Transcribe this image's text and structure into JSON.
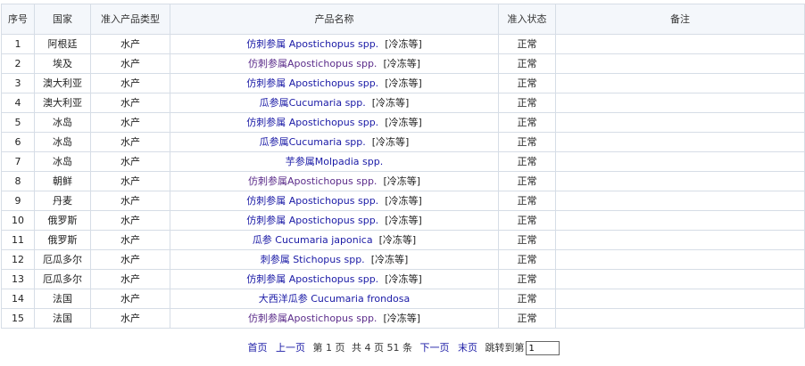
{
  "table": {
    "headers": [
      "序号",
      "国家",
      "准入产品类型",
      "产品名称",
      "准入状态",
      "备注"
    ],
    "rows": [
      {
        "idx": "1",
        "country": "阿根廷",
        "type": "水产",
        "name": "仿刺参属 Apostichopus spp.",
        "suffix": "[冷冻等]",
        "visited": false,
        "status": "正常",
        "note": ""
      },
      {
        "idx": "2",
        "country": "埃及",
        "type": "水产",
        "name": "仿刺参属Apostichopus spp.",
        "suffix": "[冷冻等]",
        "visited": true,
        "status": "正常",
        "note": ""
      },
      {
        "idx": "3",
        "country": "澳大利亚",
        "type": "水产",
        "name": "仿刺参属 Apostichopus spp.",
        "suffix": "[冷冻等]",
        "visited": false,
        "status": "正常",
        "note": ""
      },
      {
        "idx": "4",
        "country": "澳大利亚",
        "type": "水产",
        "name": "瓜参属Cucumaria spp.",
        "suffix": "[冷冻等]",
        "visited": false,
        "status": "正常",
        "note": ""
      },
      {
        "idx": "5",
        "country": "冰岛",
        "type": "水产",
        "name": "仿刺参属 Apostichopus spp.",
        "suffix": "[冷冻等]",
        "visited": false,
        "status": "正常",
        "note": ""
      },
      {
        "idx": "6",
        "country": "冰岛",
        "type": "水产",
        "name": "瓜参属Cucumaria spp.",
        "suffix": "[冷冻等]",
        "visited": false,
        "status": "正常",
        "note": ""
      },
      {
        "idx": "7",
        "country": "冰岛",
        "type": "水产",
        "name": "芋参属Molpadia spp.",
        "suffix": "",
        "visited": false,
        "status": "正常",
        "note": ""
      },
      {
        "idx": "8",
        "country": "朝鲜",
        "type": "水产",
        "name": "仿刺参属Apostichopus spp.",
        "suffix": "[冷冻等]",
        "visited": true,
        "status": "正常",
        "note": ""
      },
      {
        "idx": "9",
        "country": "丹麦",
        "type": "水产",
        "name": "仿刺参属 Apostichopus spp.",
        "suffix": "[冷冻等]",
        "visited": false,
        "status": "正常",
        "note": ""
      },
      {
        "idx": "10",
        "country": "俄罗斯",
        "type": "水产",
        "name": "仿刺参属 Apostichopus spp.",
        "suffix": "[冷冻等]",
        "visited": false,
        "status": "正常",
        "note": ""
      },
      {
        "idx": "11",
        "country": "俄罗斯",
        "type": "水产",
        "name": "瓜参 Cucumaria japonica",
        "suffix": "[冷冻等]",
        "visited": false,
        "status": "正常",
        "note": ""
      },
      {
        "idx": "12",
        "country": "厄瓜多尔",
        "type": "水产",
        "name": "刺参属 Stichopus spp.",
        "suffix": "[冷冻等]",
        "visited": false,
        "status": "正常",
        "note": ""
      },
      {
        "idx": "13",
        "country": "厄瓜多尔",
        "type": "水产",
        "name": "仿刺参属 Apostichopus spp.",
        "suffix": "[冷冻等]",
        "visited": false,
        "status": "正常",
        "note": ""
      },
      {
        "idx": "14",
        "country": "法国",
        "type": "水产",
        "name": "大西洋瓜参 Cucumaria frondosa",
        "suffix": "",
        "visited": false,
        "status": "正常",
        "note": ""
      },
      {
        "idx": "15",
        "country": "法国",
        "type": "水产",
        "name": "仿刺参属Apostichopus spp.",
        "suffix": "[冷冻等]",
        "visited": true,
        "status": "正常",
        "note": ""
      }
    ]
  },
  "pager": {
    "first": "首页",
    "prev": "上一页",
    "current_page": "第 1 页",
    "total": "共 4 页 51 条",
    "next": "下一页",
    "last": "末页",
    "jump_label": "跳转到第",
    "jump_value": "1"
  },
  "colors": {
    "link": "#1a1aa6",
    "visited_link": "#5b2c8a",
    "border": "#d6dde6",
    "header_bg": "#f4f7fb"
  }
}
